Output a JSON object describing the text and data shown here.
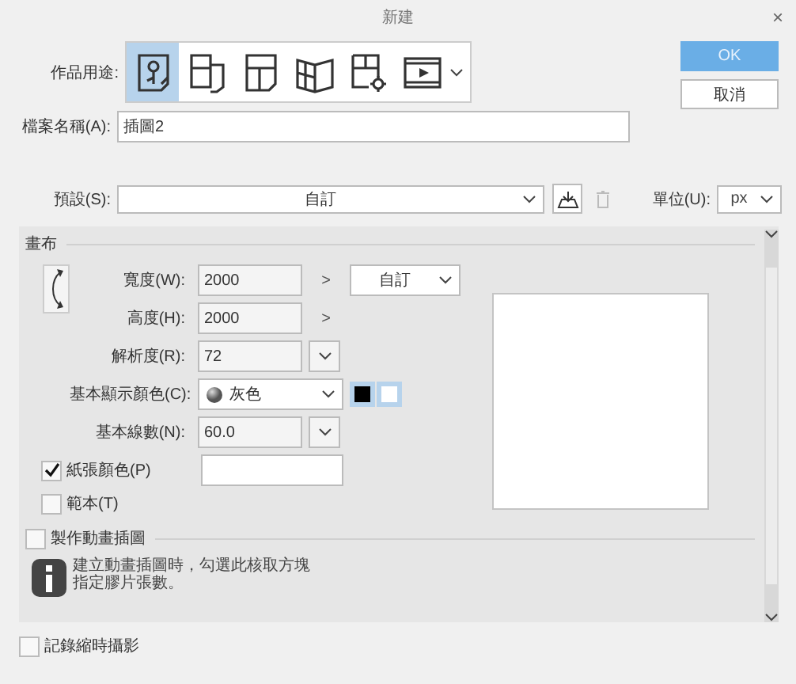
{
  "window": {
    "title": "新建",
    "close": "×"
  },
  "usage": {
    "label": "作品用途:",
    "options": [
      {
        "kind": "flower",
        "selected": true
      },
      {
        "kind": "panels",
        "selected": false
      },
      {
        "kind": "page",
        "selected": false
      },
      {
        "kind": "book",
        "selected": false
      },
      {
        "kind": "gear",
        "selected": false
      },
      {
        "kind": "film",
        "selected": false
      }
    ]
  },
  "file_name": {
    "label": "檔案名稱(A):",
    "value": "插圖2"
  },
  "buttons": {
    "ok": "OK",
    "cancel": "取消"
  },
  "preset": {
    "label": "預設(S):",
    "value": "自訂"
  },
  "unit": {
    "label": "單位(U):",
    "value": "px"
  },
  "canvas": {
    "title": "畫布",
    "width": {
      "label": "寬度(W):",
      "value": "2000",
      "arrow": ">"
    },
    "size_preset": "自訂",
    "height": {
      "label": "高度(H):",
      "value": "2000",
      "arrow": ">"
    },
    "resolution": {
      "label": "解析度(R):",
      "value": "72"
    },
    "display_color": {
      "label": "基本顯示顏色(C):",
      "value": "灰色"
    },
    "line_count": {
      "label": "基本線數(N):",
      "value": "60.0"
    },
    "paper_color": {
      "label": "紙張顏色(P)",
      "checked": true
    },
    "template": {
      "label": "範本(T)",
      "checked": false
    }
  },
  "animation": {
    "label": "製作動畫插圖",
    "checked": false,
    "info": [
      "建立動畫插圖時，勾選此核取方塊",
      "指定膠片張數。"
    ]
  },
  "timelapse": {
    "label": "記錄縮時攝影",
    "checked": false
  }
}
